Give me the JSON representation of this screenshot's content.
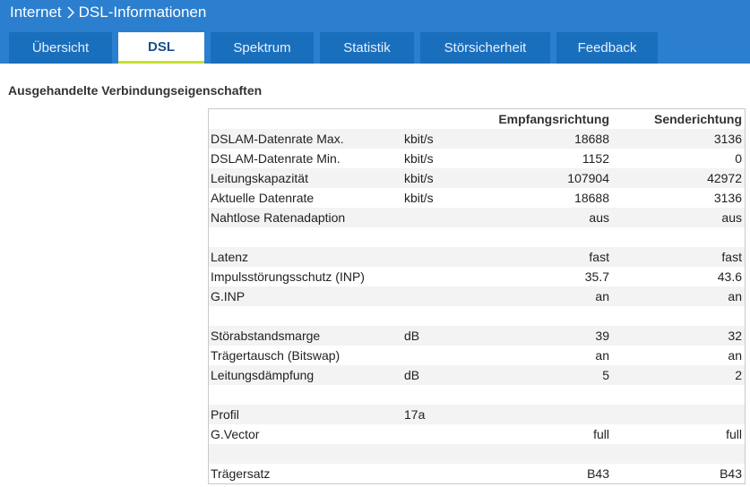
{
  "breadcrumb": {
    "parent": "Internet",
    "current": "DSL-Informationen"
  },
  "tabs": [
    {
      "label": "Übersicht",
      "active": false
    },
    {
      "label": "DSL",
      "active": true
    },
    {
      "label": "Spektrum",
      "active": false
    },
    {
      "label": "Statistik",
      "active": false
    },
    {
      "label": "Störsicherheit",
      "active": false
    },
    {
      "label": "Feedback",
      "active": false
    }
  ],
  "section_title": "Ausgehandelte Verbindungseigenschaften",
  "table": {
    "headers": {
      "receive": "Empfangsrichtung",
      "send": "Senderichtung"
    },
    "rows": [
      {
        "label": "DSLAM-Datenrate Max.",
        "unit": "kbit/s",
        "receive": "18688",
        "send": "3136"
      },
      {
        "label": "DSLAM-Datenrate Min.",
        "unit": "kbit/s",
        "receive": "1152",
        "send": "0"
      },
      {
        "label": "Leitungskapazität",
        "unit": "kbit/s",
        "receive": "107904",
        "send": "42972"
      },
      {
        "label": "Aktuelle Datenrate",
        "unit": "kbit/s",
        "receive": "18688",
        "send": "3136"
      },
      {
        "label": "Nahtlose Ratenadaption",
        "unit": "",
        "receive": "aus",
        "send": "aus"
      },
      {
        "label": "",
        "unit": "",
        "receive": "",
        "send": ""
      },
      {
        "label": "Latenz",
        "unit": "",
        "receive": "fast",
        "send": "fast"
      },
      {
        "label": "Impulsstörungsschutz (INP)",
        "unit": "",
        "receive": "35.7",
        "send": "43.6"
      },
      {
        "label": "G.INP",
        "unit": "",
        "receive": "an",
        "send": "an"
      },
      {
        "label": "",
        "unit": "",
        "receive": "",
        "send": ""
      },
      {
        "label": "Störabstandsmarge",
        "unit": "dB",
        "receive": "39",
        "send": "32"
      },
      {
        "label": "Trägertausch (Bitswap)",
        "unit": "",
        "receive": "an",
        "send": "an"
      },
      {
        "label": "Leitungsdämpfung",
        "unit": "dB",
        "receive": "5",
        "send": "2"
      },
      {
        "label": "",
        "unit": "",
        "receive": "",
        "send": ""
      },
      {
        "label": "Profil",
        "unit": "17a",
        "receive": "",
        "send": ""
      },
      {
        "label": "G.Vector",
        "unit": "",
        "receive": "full",
        "send": "full"
      },
      {
        "label": "",
        "unit": "",
        "receive": "",
        "send": ""
      },
      {
        "label": "Trägersatz",
        "unit": "",
        "receive": "B43",
        "send": "B43"
      }
    ]
  }
}
